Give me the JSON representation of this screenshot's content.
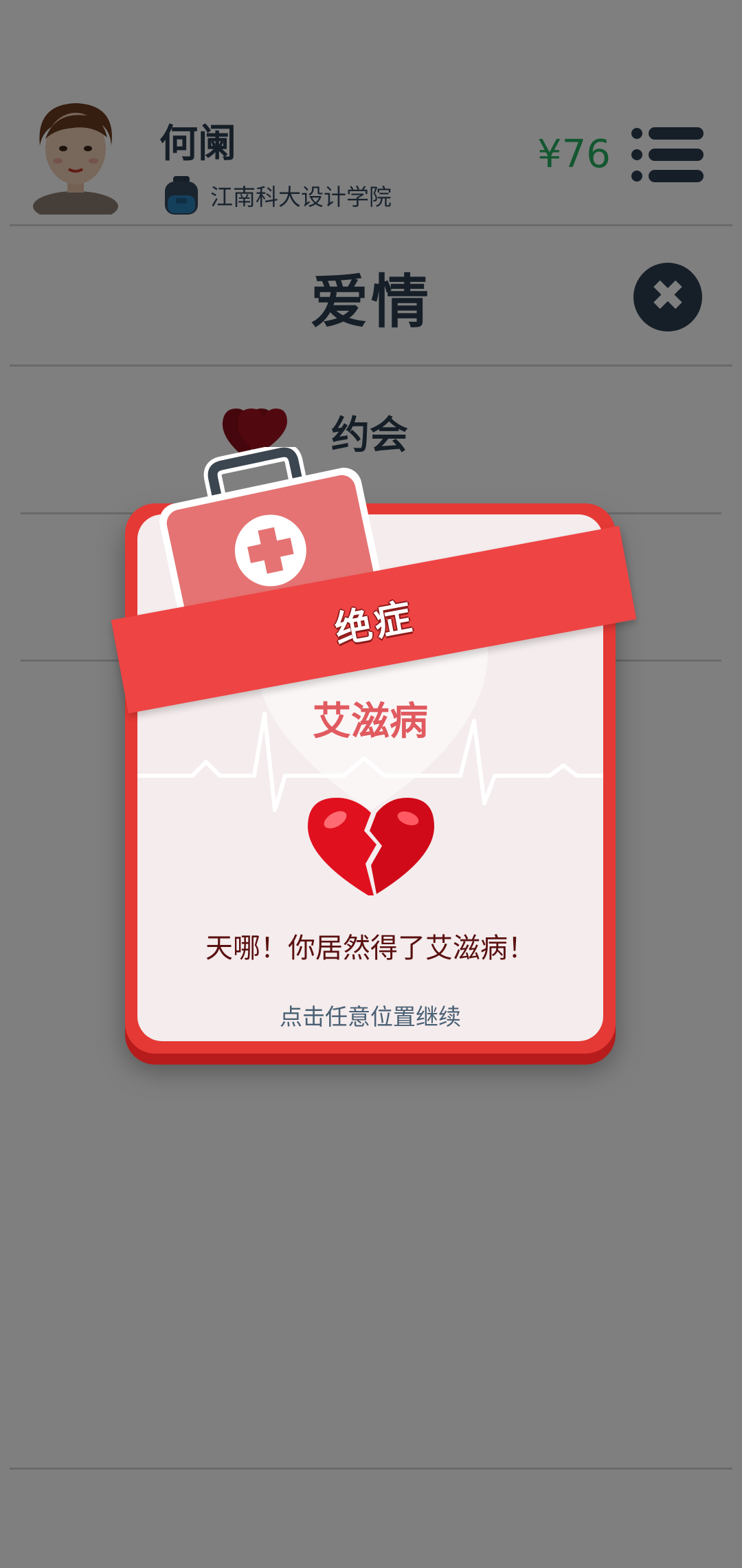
{
  "header": {
    "player_name": "何阑",
    "school": "江南科大设计学院",
    "money": "¥76"
  },
  "section": {
    "title": "爱情",
    "close_label": "✖",
    "items": [
      {
        "label": "约会",
        "icon": "double-heart-icon"
      }
    ]
  },
  "popup": {
    "category": "绝症",
    "disease": "艾滋病",
    "message": "天哪！你居然得了艾滋病！",
    "hint": "点击任意位置继续",
    "icons": [
      "medical-kit-icon",
      "broken-heart-icon",
      "heartbeat-line-icon"
    ]
  },
  "colors": {
    "dim_overlay": "rgba(0,0,0,0.5)",
    "card_border": "#e53935",
    "card_fill": "#f4eced",
    "ribbon": "#ef4444",
    "money": "#27ae60",
    "title": "#2c3e50"
  }
}
